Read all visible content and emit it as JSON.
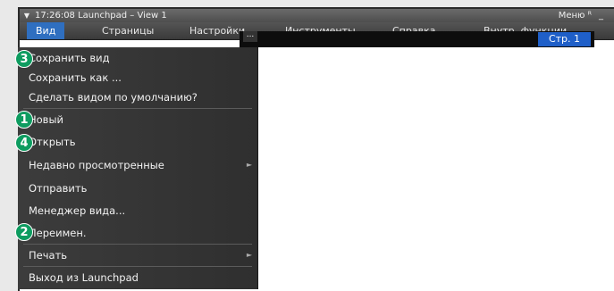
{
  "window": {
    "title": "17:26:08 Launchpad – View 1",
    "title_right": "Меню ᴿ",
    "minimize": "_"
  },
  "menubar": {
    "items": [
      "Вид",
      "Страницы",
      "Настройки",
      "Инструменты",
      "Справка",
      "Внутр. функции"
    ],
    "active": "Вид"
  },
  "toolbar": {
    "more": "...",
    "page_label": "Стр. 1"
  },
  "menu": {
    "items": [
      {
        "label": "Сохранить вид",
        "badge": "3"
      },
      {
        "label": "Сохранить как ..."
      },
      {
        "label": "Сделать видом по умолчанию?"
      },
      {
        "label": "Новый",
        "badge": "1"
      },
      {
        "label": "Открыть",
        "badge": "4"
      },
      {
        "label": "Недавно просмотренные",
        "submenu": true
      },
      {
        "label": "Отправить"
      },
      {
        "label": "Менеджер вида..."
      },
      {
        "label": "Переимен.",
        "badge": "2"
      },
      {
        "label": "Печать",
        "submenu": true
      },
      {
        "label": "Выход из Launchpad"
      }
    ],
    "submenu_arrow": "►"
  },
  "colors": {
    "menu_bg": "#363636",
    "highlight": "#2f6fc0",
    "badge": "#0e9c60",
    "page_button": "#1f5fc8"
  }
}
